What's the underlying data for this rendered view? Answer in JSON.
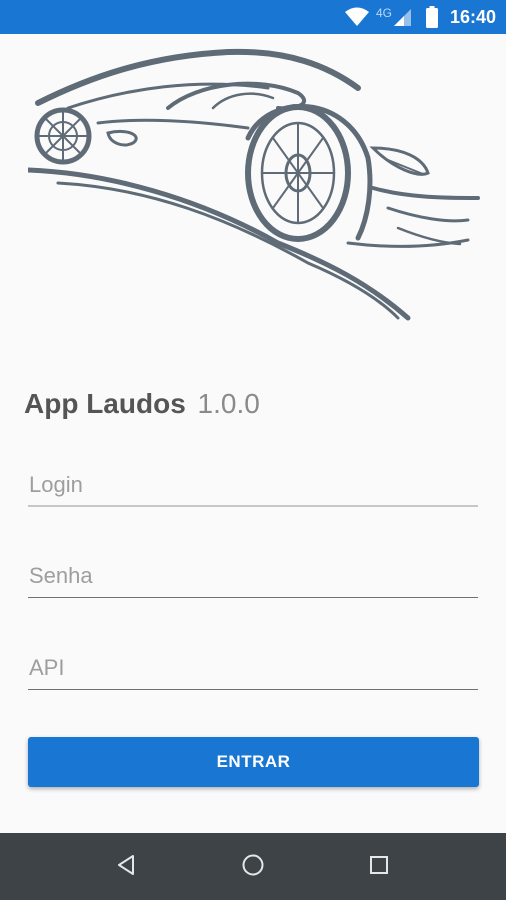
{
  "status_bar": {
    "network": "4G",
    "time": "16:40"
  },
  "app": {
    "name": "App Laudos",
    "version": "1.0.0"
  },
  "form": {
    "login_placeholder": "Login",
    "senha_placeholder": "Senha",
    "api_placeholder": "API",
    "submit_label": "ENTRAR"
  },
  "colors": {
    "primary": "#1976d2",
    "logo_stroke": "#5f6b76",
    "nav_bar": "#3e4347"
  },
  "icons": {
    "logo": "sports-car-logo",
    "back": "back-icon",
    "home": "home-icon",
    "recents": "recents-icon"
  }
}
